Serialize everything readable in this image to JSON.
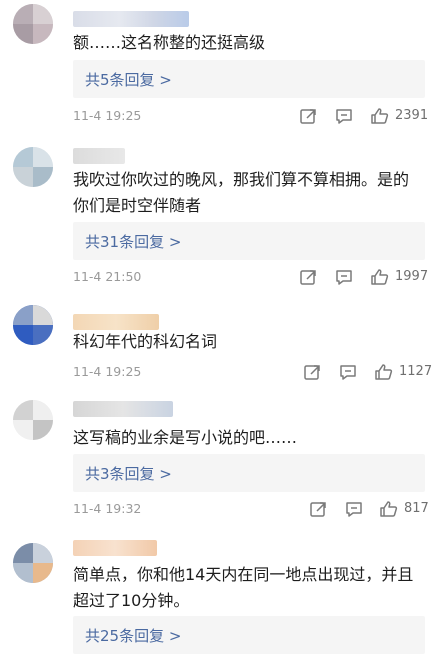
{
  "comments": [
    {
      "text_lines": [
        "额……这名称整的还挺高级"
      ],
      "replies_label": "共5条回复 >",
      "timestamp": "11-4 19:25",
      "likes": "2391"
    },
    {
      "text_lines": [
        "我吹过你吹过的晚风，那我们算不算相拥。是的",
        "你们是时空伴随者"
      ],
      "replies_label": "共31条回复 >",
      "timestamp": "11-4 21:50",
      "likes": "1997"
    },
    {
      "text_lines": [
        "科幻年代的科幻名词"
      ],
      "replies_label": "",
      "timestamp": "11-4 19:25",
      "likes": "1127"
    },
    {
      "text_lines": [
        "这写稿的业余是写小说的吧……"
      ],
      "replies_label": "共3条回复 >",
      "timestamp": "11-4 19:32",
      "likes": "817"
    },
    {
      "text_lines": [
        "简单点，你和他14天内在同一地点出现过，并且",
        "超过了10分钟。"
      ],
      "replies_label": "共25条回复 >",
      "timestamp": "",
      "likes": ""
    }
  ],
  "icons": {
    "forward": "share-icon",
    "comment": "comment-icon",
    "like": "thumbs-up-icon"
  },
  "colors": {
    "link": "#4b6aa1",
    "reply_box": "#f5f5f5",
    "meta_text": "#9a9a9a"
  }
}
